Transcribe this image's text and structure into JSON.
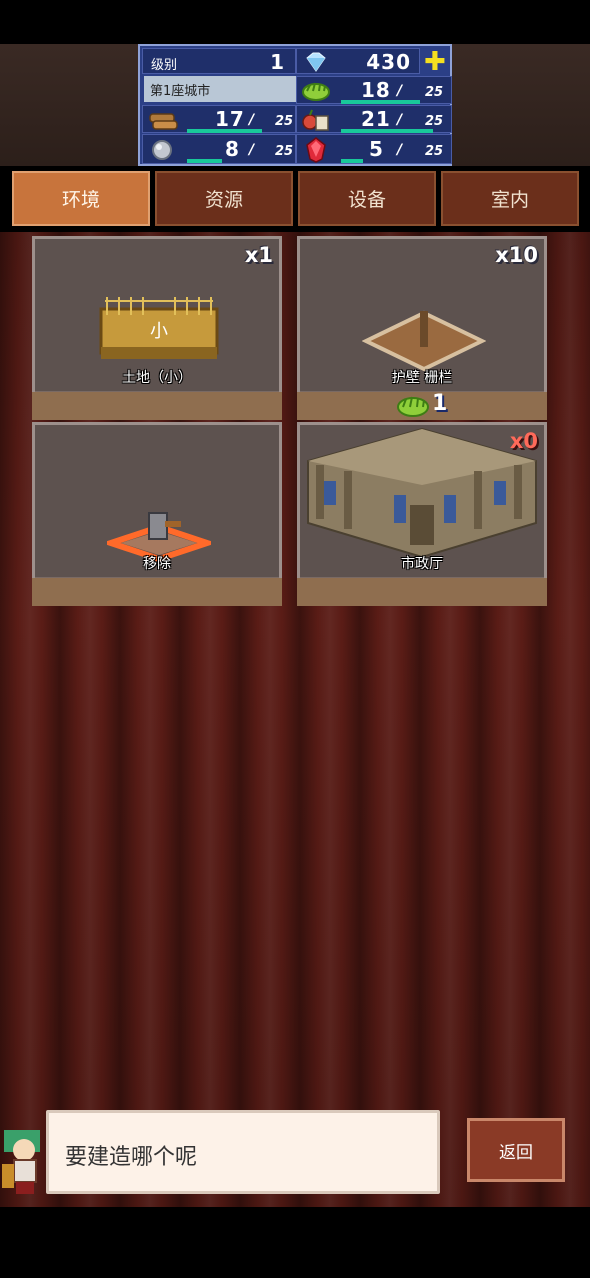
{
  "status": {
    "level_label": "级别",
    "level_value": "1",
    "gems": "430",
    "city_name": "第1座城市",
    "resources": [
      {
        "icon": "grass-icon",
        "current": "18",
        "max": "25",
        "fill": 0.72
      },
      {
        "icon": "wood-icon",
        "current": "17",
        "max": "25",
        "fill": 0.68
      },
      {
        "icon": "food-icon",
        "current": "21",
        "max": "25",
        "fill": 0.84
      },
      {
        "icon": "ore-icon",
        "current": "8",
        "max": "25",
        "fill": 0.32
      },
      {
        "icon": "ruby-icon",
        "current": "5",
        "max": "25",
        "fill": 0.2
      }
    ],
    "slash": "/"
  },
  "tabs": [
    {
      "label": "环境",
      "active": true
    },
    {
      "label": "资源",
      "active": false
    },
    {
      "label": "设备",
      "active": false
    },
    {
      "label": "室内",
      "active": false
    }
  ],
  "cards": [
    {
      "name": "土地（小）",
      "count": "x1",
      "icon": "land-plot-icon"
    },
    {
      "name": "护壁 栅栏",
      "count": "x10",
      "cost": "1",
      "cost_icon": "grass-icon",
      "icon": "fence-icon"
    },
    {
      "name": "移除",
      "icon": "hammer-icon"
    },
    {
      "name": "市政厅",
      "count": "x0",
      "icon": "city-hall-icon"
    }
  ],
  "dialog": {
    "message": "要建造哪个呢",
    "back_label": "返回"
  },
  "colors": {
    "active_tab": "#c8743c",
    "panel": "#2b3f86",
    "bar": "#19c99a"
  }
}
